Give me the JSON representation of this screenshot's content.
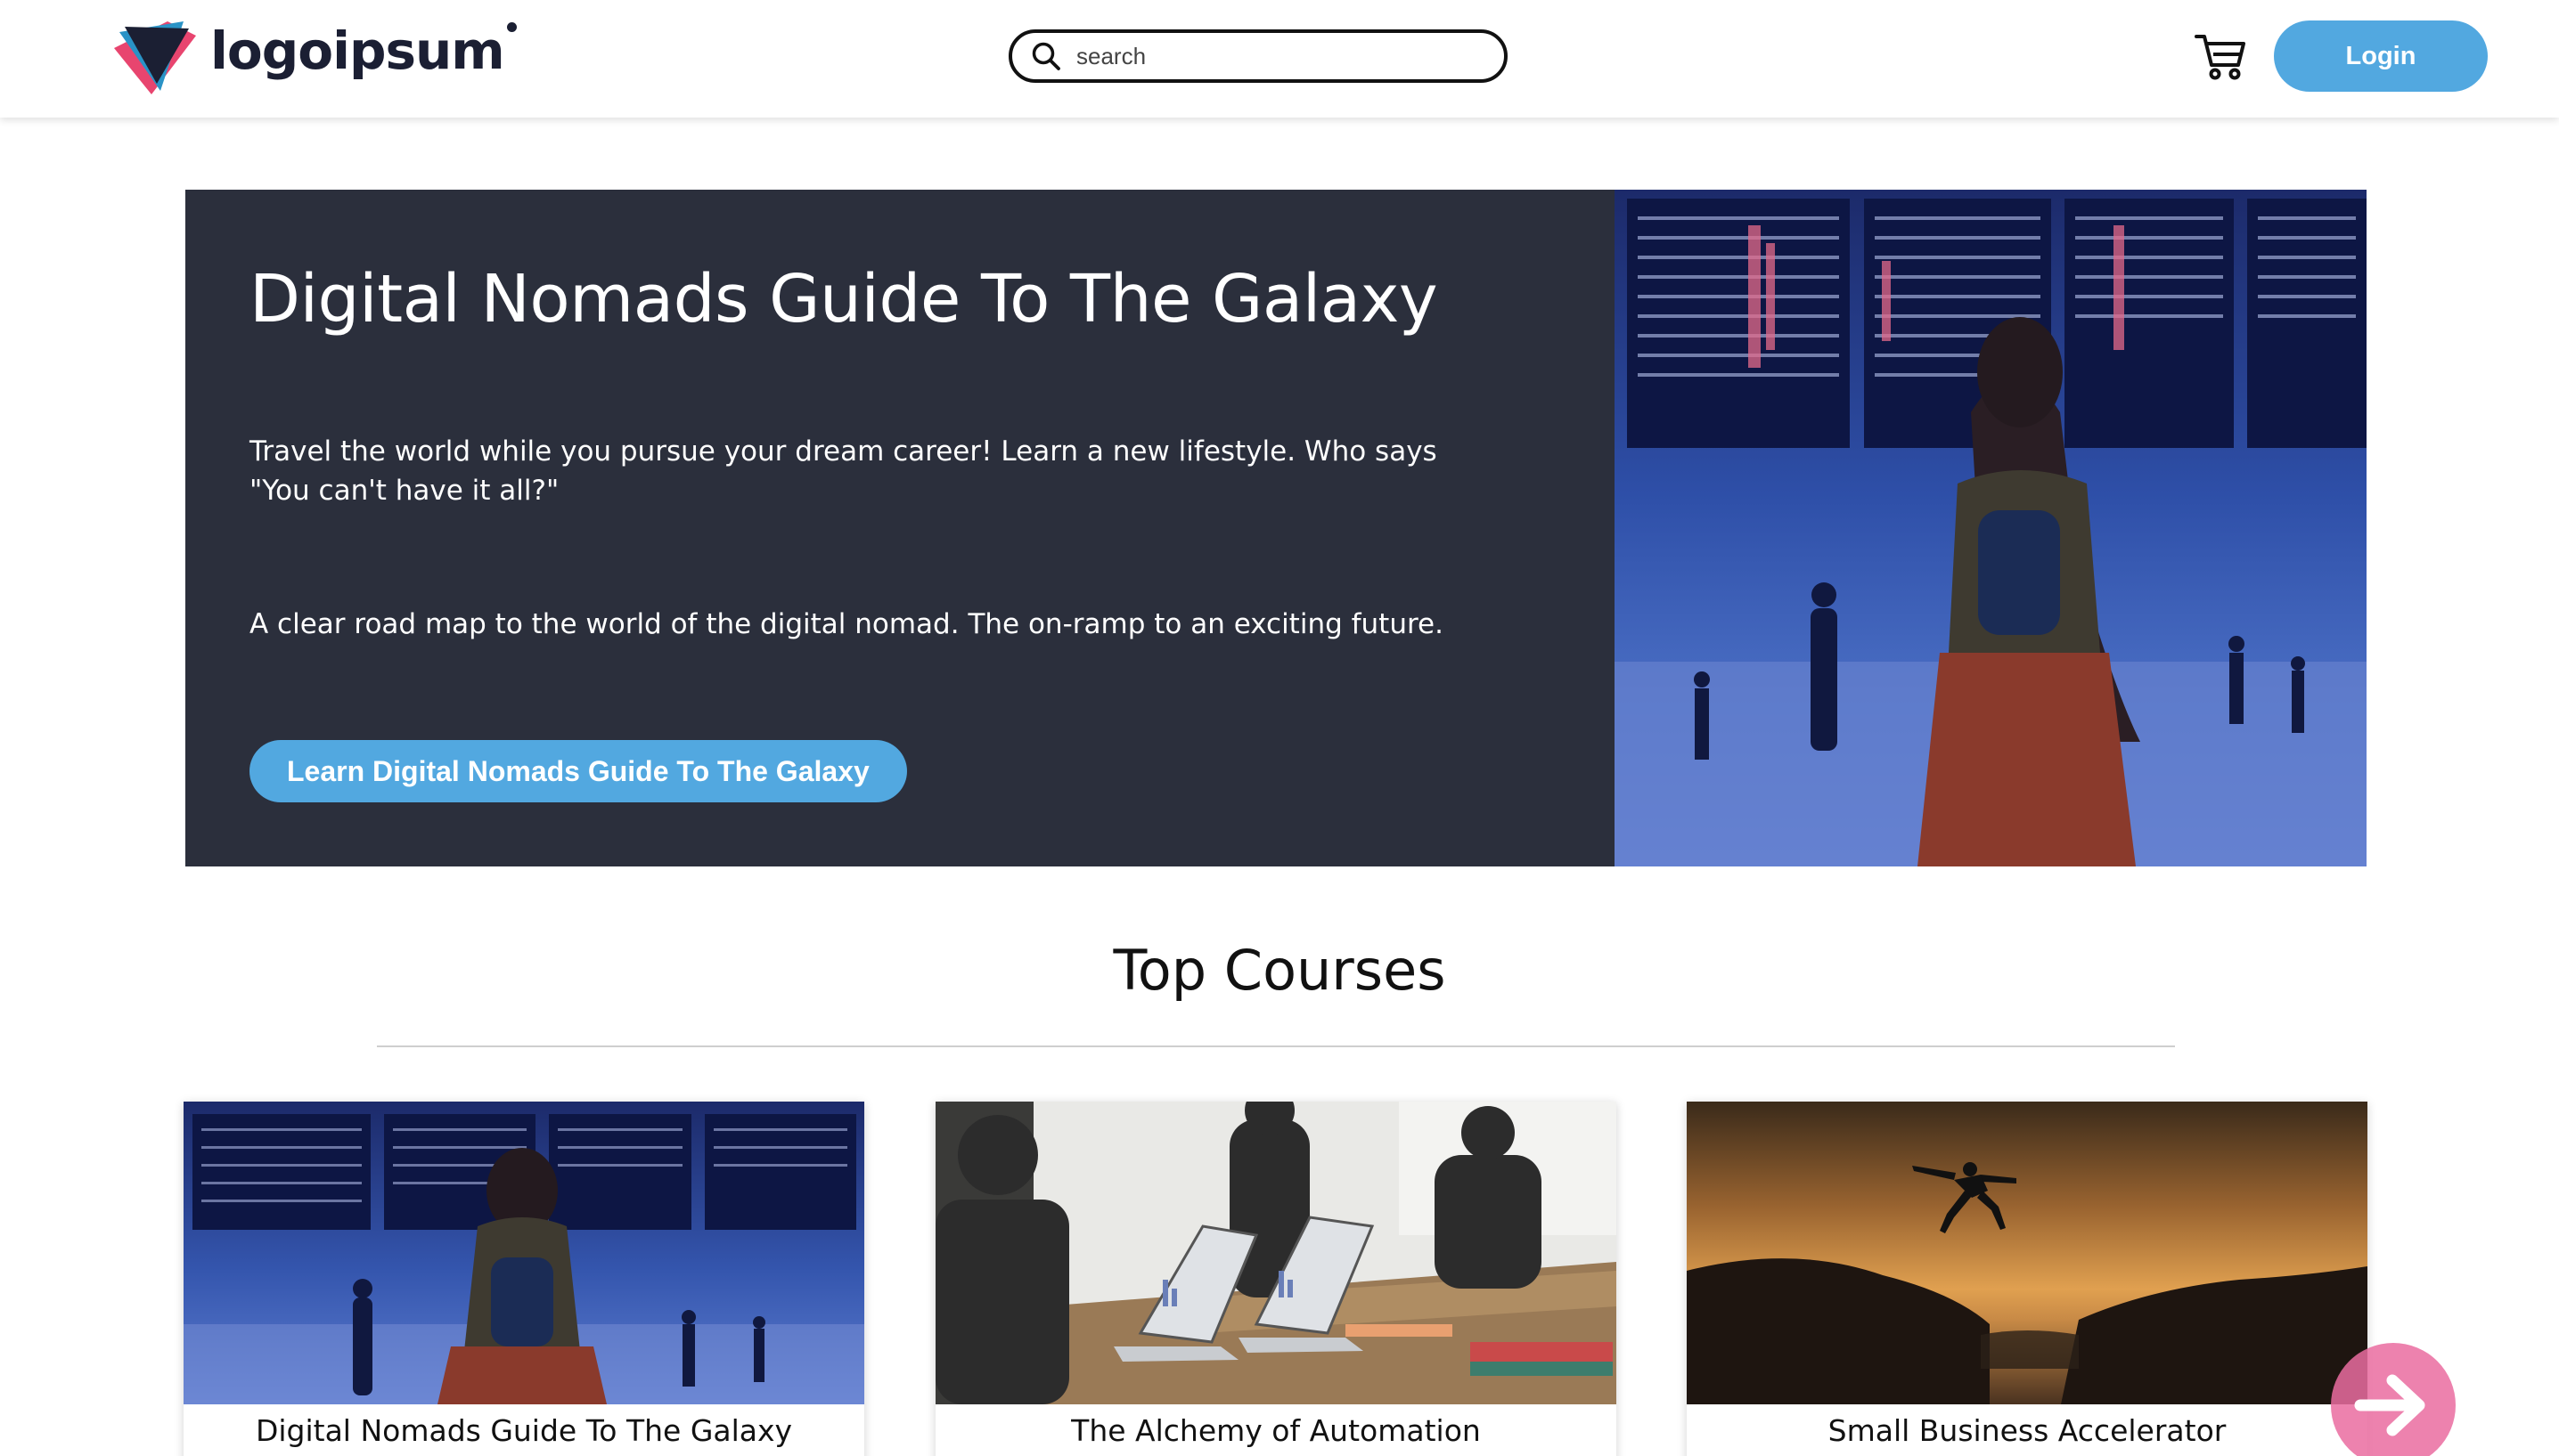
{
  "header": {
    "logo_text": "logoipsum",
    "search": {
      "placeholder": "search",
      "value": ""
    },
    "cart_icon": "shopping-cart-icon",
    "login_label": "Login"
  },
  "hero": {
    "title": "Digital Nomads Guide To The Galaxy",
    "description": "Travel the world while you pursue your dream career! Learn a new lifestyle. Who says \"You can't have it all?\"",
    "subtext": "A clear road map to the world of the digital nomad. The on-ramp to an exciting future.",
    "cta_label": "Learn Digital Nomads Guide To The Galaxy"
  },
  "top_courses": {
    "heading": "Top Courses",
    "courses": [
      {
        "title": "Digital Nomads Guide To The Galaxy"
      },
      {
        "title": "The Alchemy of Automation"
      },
      {
        "title": "Small Business Accelerator"
      }
    ],
    "next_icon": "arrow-right-icon"
  },
  "colors": {
    "accent": "#52a8e0",
    "hero_bg": "#2b2f3c",
    "logo_dark": "#1b1f33",
    "next_button": "#ea6ca0"
  }
}
